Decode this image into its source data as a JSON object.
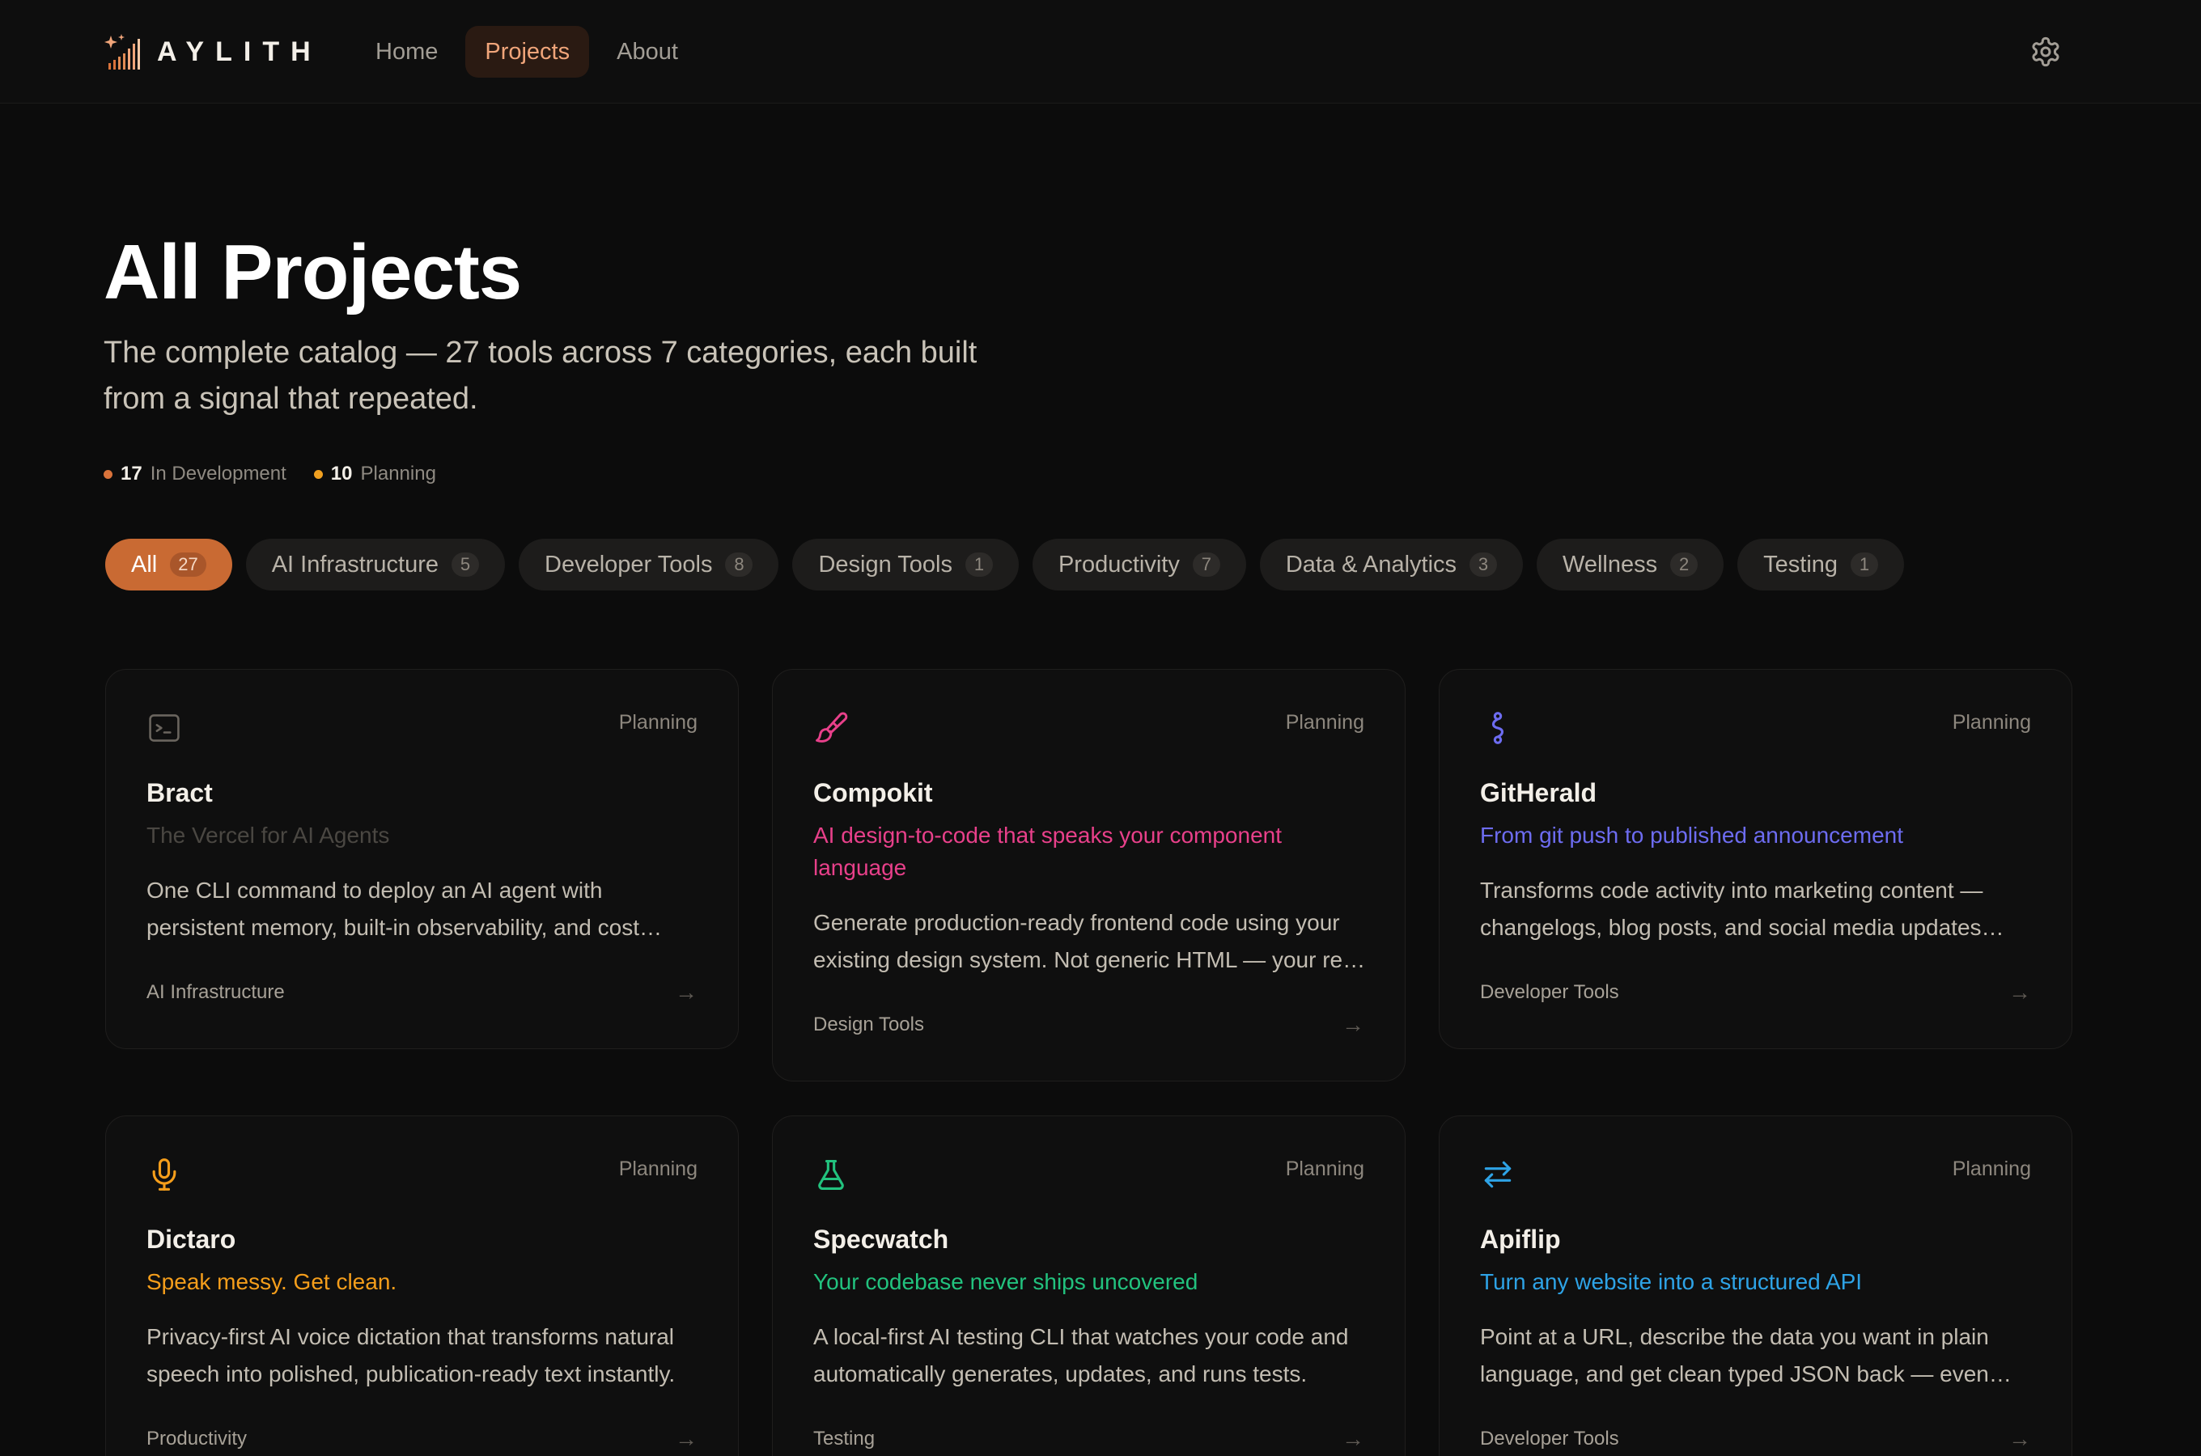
{
  "brand": {
    "name": "AYLITH",
    "accent": "#c96a33"
  },
  "nav": {
    "items": [
      {
        "label": "Home",
        "active": false
      },
      {
        "label": "Projects",
        "active": true
      },
      {
        "label": "About",
        "active": false
      }
    ],
    "settings_icon": "gear-icon"
  },
  "hero": {
    "title": "All Projects",
    "subtitle": "The complete catalog — 27 tools across 7 categories, each built from a signal that repeated."
  },
  "stats": [
    {
      "count": "17",
      "label": "In Development",
      "color": "#d9733b"
    },
    {
      "count": "10",
      "label": "Planning",
      "color": "#f0a020"
    }
  ],
  "filters": [
    {
      "label": "All",
      "count": "27",
      "active": true
    },
    {
      "label": "AI Infrastructure",
      "count": "5",
      "active": false
    },
    {
      "label": "Developer Tools",
      "count": "8",
      "active": false
    },
    {
      "label": "Design Tools",
      "count": "1",
      "active": false
    },
    {
      "label": "Productivity",
      "count": "7",
      "active": false
    },
    {
      "label": "Data & Analytics",
      "count": "3",
      "active": false
    },
    {
      "label": "Wellness",
      "count": "2",
      "active": false
    },
    {
      "label": "Testing",
      "count": "1",
      "active": false
    }
  ],
  "projects": [
    {
      "name": "Bract",
      "status": "Planning",
      "tagline": "The Vercel for AI Agents",
      "tagline_color": "#4a4742",
      "description": "One CLI command to deploy an AI agent with persistent memory, built-in observability, and cost controls out of the box.",
      "category": "AI Infrastructure",
      "icon": "terminal-icon",
      "icon_color": "#6a655e",
      "arrow": "→"
    },
    {
      "name": "Compokit",
      "status": "Planning",
      "tagline": "AI design-to-code that speaks your component language",
      "tagline_color": "#e8408a",
      "description": "Generate production-ready frontend code using your existing design system. Not generic HTML — your real components.",
      "category": "Design Tools",
      "icon": "paintbrush-icon",
      "icon_color": "#e8408a",
      "arrow": "→"
    },
    {
      "name": "GitHerald",
      "status": "Planning",
      "tagline": "From git push to published announcement",
      "tagline_color": "#6d6cf0",
      "description": "Transforms code activity into marketing content — changelogs, blog posts, and social media updates automatically.",
      "category": "Developer Tools",
      "icon": "git-branch-icon",
      "icon_color": "#6d6cf0",
      "arrow": "→"
    },
    {
      "name": "Dictaro",
      "status": "Planning",
      "tagline": "Speak messy. Get clean.",
      "tagline_color": "#f59e1b",
      "description": "Privacy-first AI voice dictation that transforms natural speech into polished, publication-ready text instantly.",
      "category": "Productivity",
      "icon": "microphone-icon",
      "icon_color": "#f59e1b",
      "arrow": "→"
    },
    {
      "name": "Specwatch",
      "status": "Planning",
      "tagline": "Your codebase never ships uncovered",
      "tagline_color": "#22c27e",
      "description": "A local-first AI testing CLI that watches your code and automatically generates, updates, and runs tests.",
      "category": "Testing",
      "icon": "flask-icon",
      "icon_color": "#22c27e",
      "arrow": "→"
    },
    {
      "name": "Apiflip",
      "status": "Planning",
      "tagline": "Turn any website into a structured API",
      "tagline_color": "#2ea3e6",
      "description": "Point at a URL, describe the data you want in plain language, and get clean typed JSON back — even from dynamic pages.",
      "category": "Developer Tools",
      "icon": "swap-arrows-icon",
      "icon_color": "#2ea3e6",
      "arrow": "→"
    }
  ]
}
